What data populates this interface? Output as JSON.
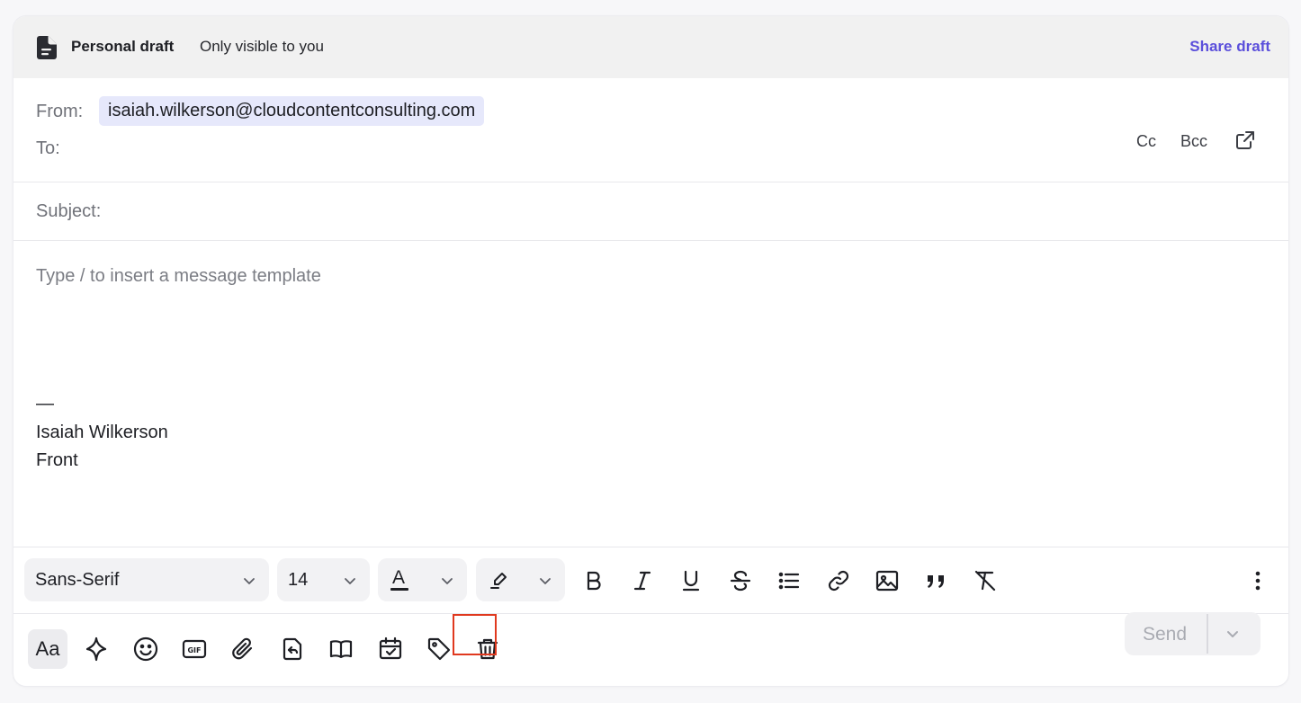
{
  "banner": {
    "title": "Personal draft",
    "subtitle": "Only visible to you",
    "share_label": "Share draft"
  },
  "header": {
    "from_label": "From:",
    "from_address": "isaiah.wilkerson@cloudcontentconsulting.com",
    "to_label": "To:",
    "cc_label": "Cc",
    "bcc_label": "Bcc",
    "subject_label": "Subject:"
  },
  "body": {
    "placeholder": "Type / to insert a message template",
    "signature_dash": "—",
    "signature_name": "Isaiah Wilkerson",
    "signature_company": "Front"
  },
  "format_toolbar": {
    "font_family": "Sans-Serif",
    "font_size": "14",
    "text_color_label": "A"
  },
  "action_toolbar": {
    "text_format_label": "Aa",
    "send_label": "Send"
  },
  "colors": {
    "accent": "#5b4fdb",
    "chip_bg": "#e6e8fb",
    "highlight_border": "#e0391f"
  }
}
